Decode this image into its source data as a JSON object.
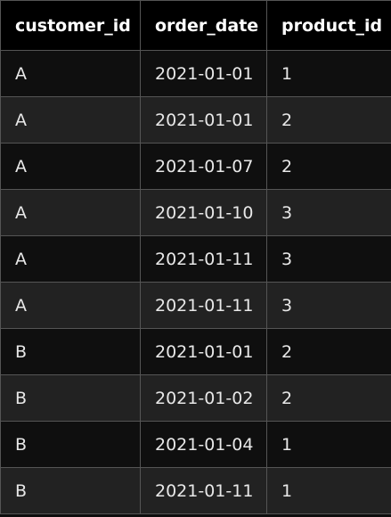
{
  "table": {
    "headers": [
      "customer_id",
      "order_date",
      "product_id"
    ],
    "rows": [
      [
        "A",
        "2021-01-01",
        "1"
      ],
      [
        "A",
        "2021-01-01",
        "2"
      ],
      [
        "A",
        "2021-01-07",
        "2"
      ],
      [
        "A",
        "2021-01-10",
        "3"
      ],
      [
        "A",
        "2021-01-11",
        "3"
      ],
      [
        "A",
        "2021-01-11",
        "3"
      ],
      [
        "B",
        "2021-01-01",
        "2"
      ],
      [
        "B",
        "2021-01-02",
        "2"
      ],
      [
        "B",
        "2021-01-04",
        "1"
      ],
      [
        "B",
        "2021-01-11",
        "1"
      ]
    ]
  },
  "colors": {
    "background": "#0d0d0d",
    "header_bg": "#000000",
    "row_odd": "#0f0f0f",
    "row_even": "#222222",
    "border": "#555555",
    "text": "#e8e8e8"
  }
}
